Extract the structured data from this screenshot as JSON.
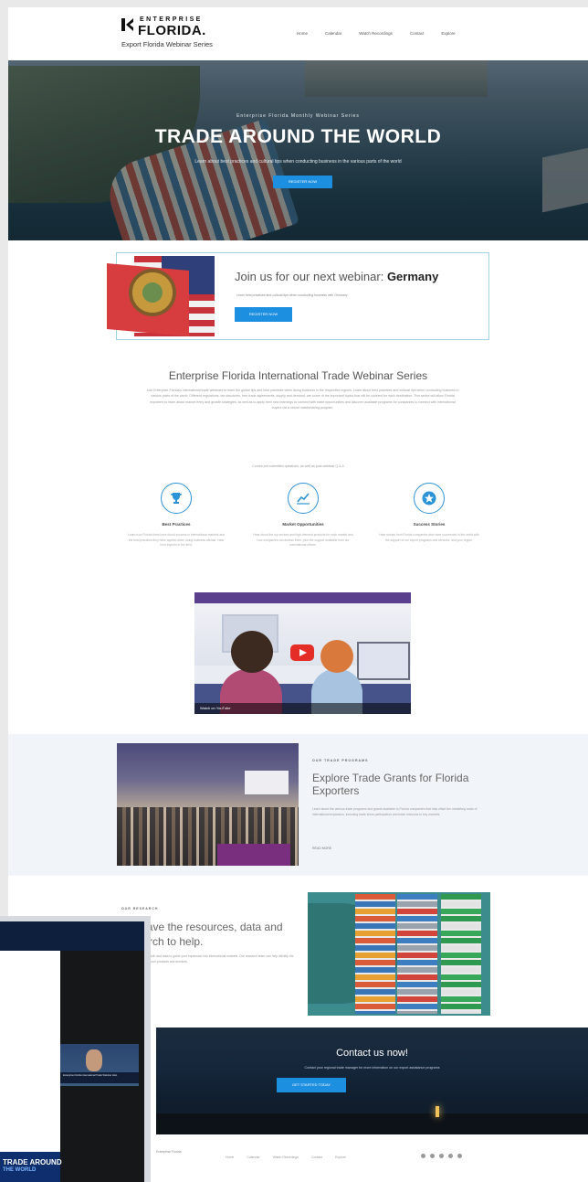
{
  "header": {
    "logo_top": "ENTERPRISE",
    "logo_main": "FLORIDA.",
    "logo_sub": "Export Florida Webinar Series",
    "nav": [
      "Home",
      "Calendar",
      "Watch Recordings",
      "Contact",
      "Explore"
    ]
  },
  "hero": {
    "kicker": "Enterprise Florida Monthly Webinar Series",
    "title": "TRADE AROUND THE WORLD",
    "subtitle": "Learn about best practices and cultural tips when conducting business in the various parts of the world",
    "button": "REGISTER NOW"
  },
  "callout": {
    "title_prefix": "Join us for our next webinar:",
    "title_country": "Germany",
    "text": "Learn best practices and cultural tips when conducting business with Germany",
    "button": "REGISTER NOW"
  },
  "series": {
    "title": "Enterprise Florida International Trade Webinar Series",
    "body": "Join Enterprise Florida's international trade webinars to learn the global tips and best practices when doing business in the respective regions. Learn about best practices and cultural tips when conducting business in various parts of the world. Different regulations, tax structures, free trade agreements, supply and demand, are some of the important topics that will be covered for each destination. This series will allow Florida exporters to learn about market entry and growth strategies, as well as to apply their new learnings to connect with trade opportunities and discover available programs for companies to connect with international buyers via a virtual matchmaking program.",
    "note": "Comes pre-submitted questions, as well as post-webinar Q & A"
  },
  "features": [
    {
      "title": "Best Practices",
      "text": "Learn how Florida firms have found success in international markets and the best practices they have applied when doing business abroad. Hear from experts in the field."
    },
    {
      "title": "Market Opportunities",
      "text": "Hear about the top sectors and high-demand products for each market and how companies can access them, plus the support available from our international offices."
    },
    {
      "title": "Success Stories",
      "text": "Hear stories from Florida companies who have succeeded in the world with the support of our export programs and services, and your region."
    }
  ],
  "video": {
    "watch_label": "Watch on YouTube"
  },
  "grants": {
    "kicker": "OUR TRADE PROGRAMS",
    "title": "Explore Trade Grants for Florida Exporters",
    "body": "Learn about the various trade programs and grants available to Florida companies that help offset the marketing costs of international expansion, including trade show participation and trade missions to key markets.",
    "link": "READ MORE"
  },
  "resources": {
    "kicker": "OUR RESEARCH",
    "title": "We have the resources, data and research to help.",
    "body": "Use our market research and data to guide your expansion into international markets. Our research team can help identify the best destinations for your products and services."
  },
  "contact": {
    "title": "Contact us now!",
    "subtitle": "Contact your regional trade manager for more information on our export assistance programs",
    "button": "GET STARTED TODAY"
  },
  "footer": {
    "text": "Enterprise Florida",
    "nav": [
      "Home",
      "Calendar",
      "Watch Recordings",
      "Contact",
      "Explore"
    ],
    "social_icons": [
      "facebook-icon",
      "twitter-icon",
      "instagram-icon",
      "linkedin-icon",
      "youtube-icon"
    ]
  },
  "overlay": {
    "caption": "Enterprise Florida International Trade Webinar Host",
    "brand_line1": "TRADE AROUND",
    "brand_line2": "THE WORLD"
  },
  "colors": {
    "accent": "#1d8fe0",
    "icon_ring": "#2c94d6",
    "band": "#f1f5fa"
  }
}
